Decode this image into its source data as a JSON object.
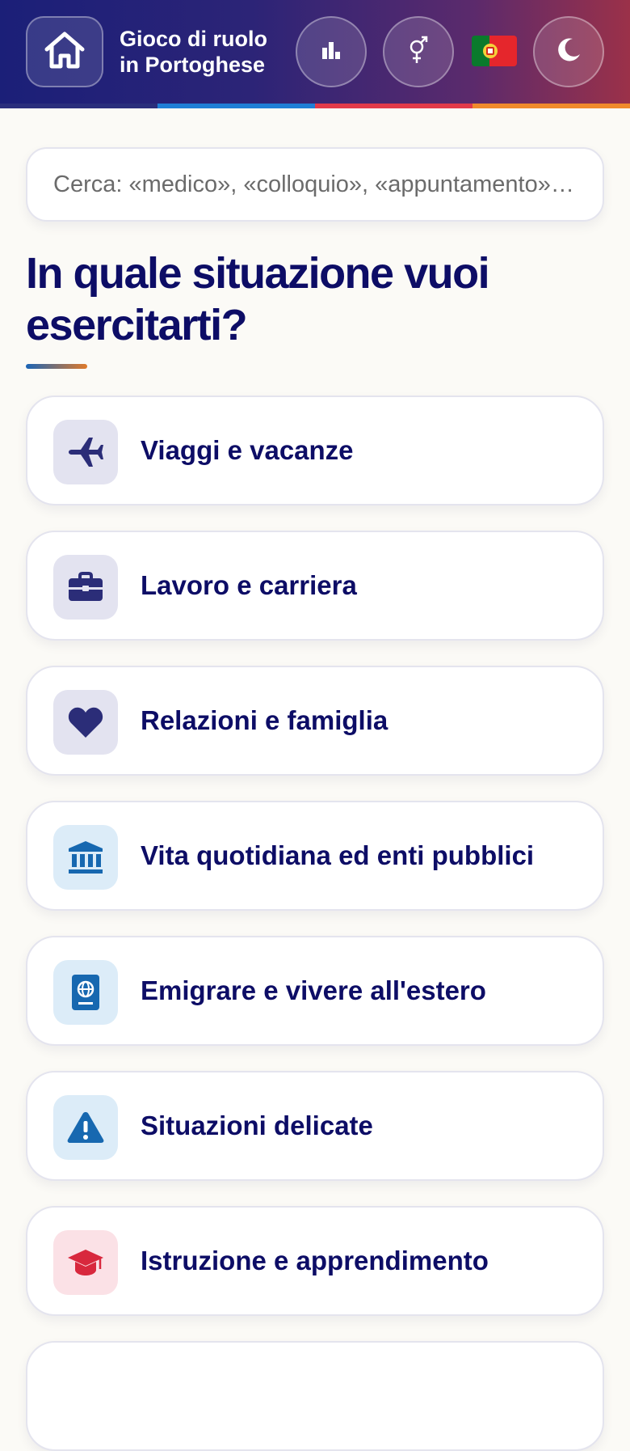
{
  "header": {
    "title_line1": "Gioco di ruolo",
    "title_line2": "in Portoghese",
    "home_icon": "home-icon",
    "stats_icon": "bar-chart-icon",
    "gender_icon": "gender-icon",
    "flag_icon": "portugal-flag-icon",
    "theme_icon": "moon-icon",
    "stripe_colors": [
      "#2a2e7c",
      "#1f7fd6",
      "#e23a4a",
      "#f08a2c"
    ]
  },
  "search": {
    "placeholder": "Cerca: «medico», «colloquio», «appuntamento»…"
  },
  "main": {
    "heading": "In quale situazione vuoi esercitarti?"
  },
  "categories": [
    {
      "label": "Viaggi e vacanze",
      "icon": "airplane-icon",
      "tint": "#e3e3f0",
      "color": "#2b2d78"
    },
    {
      "label": "Lavoro e carriera",
      "icon": "briefcase-icon",
      "tint": "#e3e3f0",
      "color": "#2b2d78"
    },
    {
      "label": "Relazioni e famiglia",
      "icon": "heart-icon",
      "tint": "#e3e3f0",
      "color": "#2b2d78"
    },
    {
      "label": "Vita quotidiana ed enti pubblici",
      "icon": "government-building-icon",
      "tint": "#dcecf8",
      "color": "#1768b0"
    },
    {
      "label": "Emigrare e vivere all'estero",
      "icon": "passport-icon",
      "tint": "#dcecf8",
      "color": "#1768b0"
    },
    {
      "label": "Situazioni delicate",
      "icon": "warning-icon",
      "tint": "#dcecf8",
      "color": "#1768b0"
    },
    {
      "label": "Istruzione e apprendimento",
      "icon": "graduation-cap-icon",
      "tint": "#fbe1e6",
      "color": "#d8283d"
    }
  ]
}
